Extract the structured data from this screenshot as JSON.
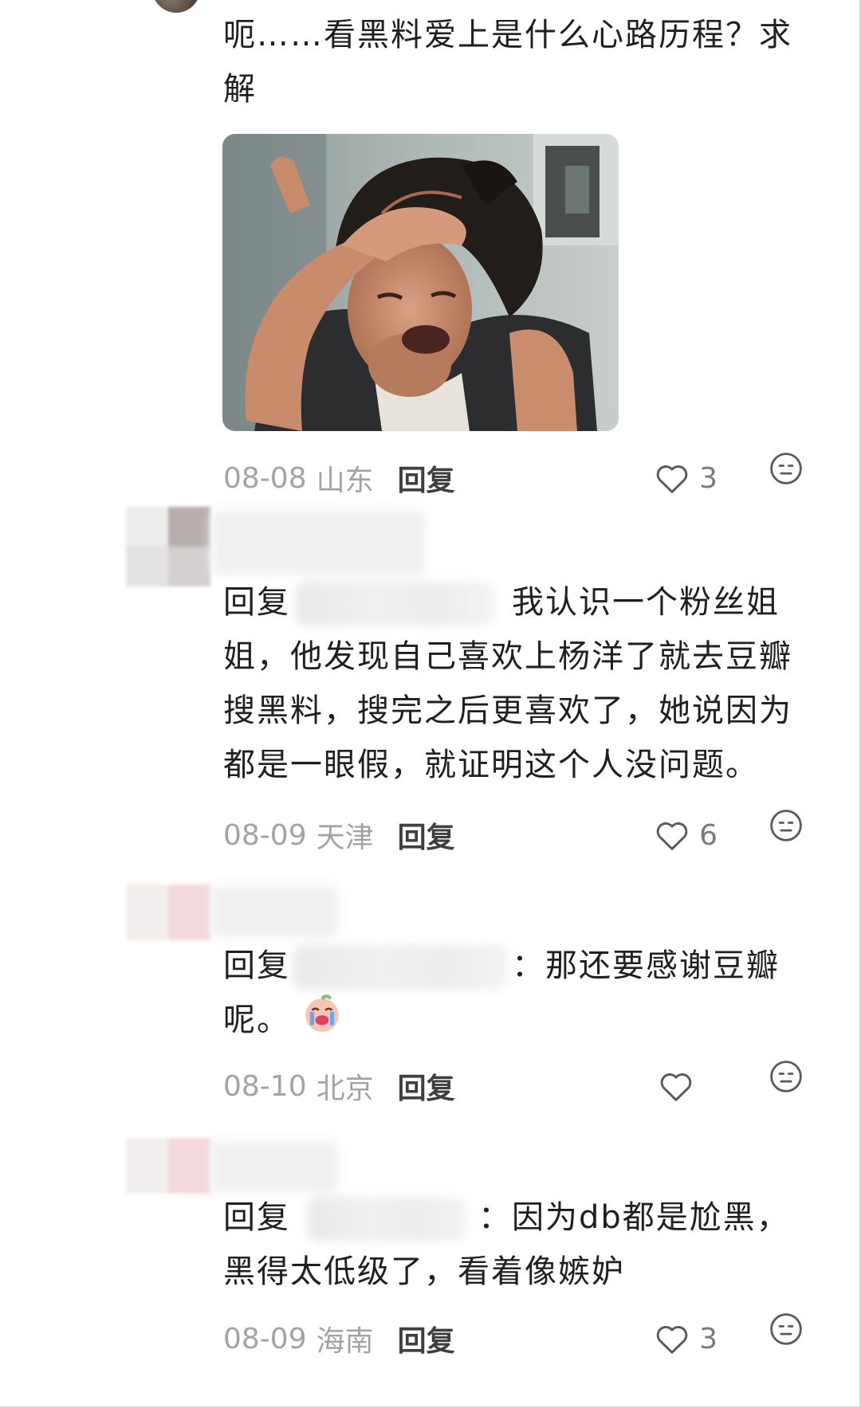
{
  "comments": [
    {
      "text": "呃……看黑料爱上是什么心路历程？求解",
      "date": "08-08",
      "location": "山东",
      "reply_label": "回复",
      "likes": "3"
    },
    {
      "reply_prefix": "回复",
      "text": "我认识一个粉丝姐姐，他发现自己喜欢上杨洋了就去豆瓣搜黑料，搜完之后更喜欢了，她说因为都是一眼假，就证明这个人没问题。",
      "date": "08-09",
      "location": "天津",
      "reply_label": "回复",
      "likes": "6"
    },
    {
      "reply_prefix": "回复",
      "separator": "：",
      "text": "那还要感谢豆瓣呢。",
      "date": "08-10",
      "location": "北京",
      "reply_label": "回复",
      "likes": ""
    },
    {
      "reply_prefix": "回复",
      "separator": "：",
      "text": "因为db都是尬黑，黑得太低级了，看着像嫉妒",
      "date": "08-09",
      "location": "海南",
      "reply_label": "回复",
      "likes": "3"
    }
  ],
  "icons": {
    "like": "heart-outline-icon",
    "emoji": "neutral-face-icon",
    "sticker": "crying-emoji-sticker"
  },
  "colors": {
    "text": "#1f1f1f",
    "meta": "#a3a3a3",
    "reply": "#3f3f3f",
    "icon": "#5a5a5a"
  }
}
